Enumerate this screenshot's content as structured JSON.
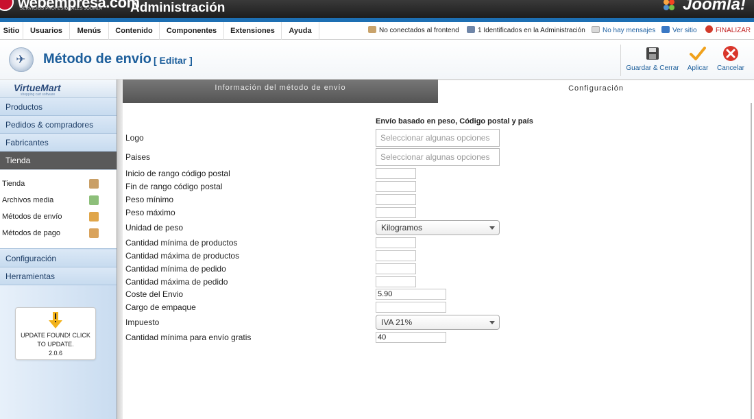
{
  "header": {
    "brand_name": "webempresa.com",
    "brand_sub": "SERVICIOS PROFESIONALES JOOMLA",
    "app_title": "Administración",
    "joomla_label": "Joomla!"
  },
  "menubar": {
    "items": [
      "Sitio",
      "Usuarios",
      "Menús",
      "Contenido",
      "Componentes",
      "Extensiones",
      "Ayuda"
    ],
    "status": {
      "frontend": "No conectados al frontend",
      "admin": "1 Identificados en la Administración",
      "messages": "No hay mensajes",
      "view_site": "Ver sitio",
      "logout": "FINALIZAR"
    }
  },
  "titlebar": {
    "title": "Método de envío",
    "edit_tag": "[ Editar ]",
    "buttons": {
      "save_close": "Guardar & Cerrar",
      "apply": "Aplicar",
      "cancel": "Cancelar"
    }
  },
  "sidebar": {
    "logo_text": "VirtueMart",
    "logo_sub": "shopping cart software",
    "sections": [
      "Productos",
      "Pedidos & compradores",
      "Fabricantes",
      "Tienda",
      "Configuración",
      "Herramientas"
    ],
    "tienda_items": [
      "Tienda",
      "Archivos media",
      "Métodos de envío",
      "Métodos de pago"
    ],
    "update_line1": "UPDATE FOUND! CLICK",
    "update_line2": "TO UPDATE.",
    "update_version": "2.0.6"
  },
  "tabs": {
    "info": "Información del método de envío",
    "config": "Configuración"
  },
  "form": {
    "heading": "Envío basado en peso, Código postal y país",
    "logo_label": "Logo",
    "logo_placeholder": "Seleccionar algunas opciones",
    "countries_label": "Paises",
    "countries_placeholder": "Seleccionar algunas opciones",
    "zip_start_label": "Inicio de rango código postal",
    "zip_end_label": "Fin de rango código postal",
    "weight_min_label": "Peso mínimo",
    "weight_max_label": "Peso máximo",
    "weight_unit_label": "Unidad de peso",
    "weight_unit_value": "Kilogramos",
    "qty_min_label": "Cantidad mínima de productos",
    "qty_max_label": "Cantidad máxima de productos",
    "order_min_label": "Cantidad mínima de pedido",
    "order_max_label": "Cantidad máxima de pedido",
    "cost_label": "Coste del Envio",
    "cost_value": "5.90",
    "package_fee_label": "Cargo de empaque",
    "package_fee_value": "",
    "tax_label": "Impuesto",
    "tax_value": "IVA 21%",
    "free_shipping_label": "Cantidad mínima para envío gratis",
    "free_shipping_value": "40"
  },
  "colors": {
    "accent_blue": "#1c5e9b",
    "header_dark": "#1d1d1d",
    "header_blue": "#1d6fb3",
    "active_section": "#5a5a5a",
    "cancel_red": "#d9362b",
    "apply_orange": "#f0a11c"
  }
}
